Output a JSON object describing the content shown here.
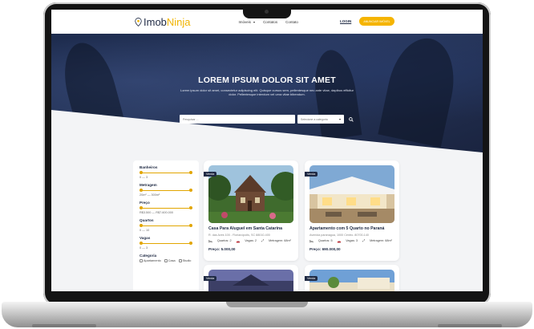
{
  "brand": {
    "part1": "Imob",
    "part2": "Ninja"
  },
  "nav": {
    "items": [
      "Imóveis",
      "Contatos",
      "Contato"
    ],
    "login": "LOGIN",
    "cta": "ANUNCIAR IMÓVEL"
  },
  "hero": {
    "title": "LOREM IPSUM DOLOR SIT AMET",
    "subtitle": "Lorem ipsum dolor sit amet, consectetur adipiscing elit. Quisque cursus sem, pellentesque nec ante vitae, dapibus efficitur dolor. Pellentesque interdum vel urna vitae bibendum.",
    "search_placeholder": "Pesquisar ...",
    "select_placeholder": "Selecione a categoria"
  },
  "filters": {
    "groups": [
      {
        "label": "Banheiros",
        "range": "0 — 3"
      },
      {
        "label": "Metragem",
        "range": "20m² — 300m²"
      },
      {
        "label": "Preço",
        "range": "R$3.500 — R$7.600.000"
      },
      {
        "label": "Quartos",
        "range": "0 — 10"
      },
      {
        "label": "Vagas",
        "range": "0 — 3"
      }
    ],
    "category_title": "Categoria",
    "categories": [
      "Apartamento",
      "Casa",
      "Studio"
    ]
  },
  "cards": [
    {
      "tag": "Venda",
      "title": "Casa Para Aluguel em Santa Catarina",
      "address": "R. das Aves 100 - Florianópolis, SC 88010-400",
      "quartos": "Quartos: 2",
      "vagas": "Vagas: 2",
      "metragem": "Metragem: 68m²",
      "price": "Preço: 5.000,00"
    },
    {
      "tag": "Venda",
      "title": "Apartamento com 5 Quarto no Paraná",
      "address": "Avenida paranagua, 1000 Centro. 80700-140",
      "quartos": "Quartos: 5",
      "vagas": "Vagas: 3",
      "metragem": "Metragem: 68m²",
      "price": "Preço: 690.000,00"
    },
    {
      "tag": "Venda"
    },
    {
      "tag": "Venda"
    }
  ]
}
